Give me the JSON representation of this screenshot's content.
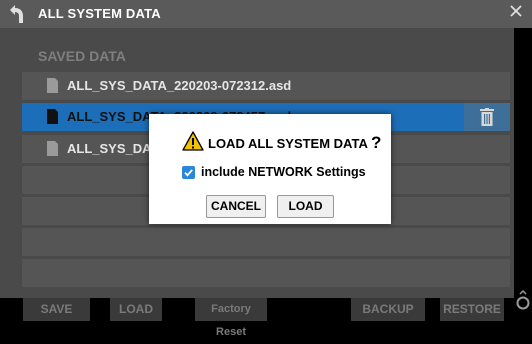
{
  "header": {
    "title": "ALL SYSTEM DATA"
  },
  "section": {
    "label": "SAVED DATA"
  },
  "files": [
    {
      "name": "ALL_SYS_DATA_220203-072312.asd",
      "selected": false
    },
    {
      "name": "ALL_SYS_DATA_220203-072457.asd",
      "selected": true
    },
    {
      "name": "ALL_SYS_DATA_",
      "selected": false
    }
  ],
  "footer": {
    "save": "SAVE",
    "load": "LOAD",
    "factory_reset": "Factory Reset",
    "backup": "BACKUP",
    "restore": "RESTORE"
  },
  "dialog": {
    "title": "LOAD ALL SYSTEM DATA",
    "question_mark": "?",
    "checkbox_label": "include NETWORK Settings",
    "checkbox_checked": true,
    "cancel": "CANCEL",
    "load": "LOAD"
  },
  "colors": {
    "selection": "#1d6eb8",
    "checkbox": "#2a86d8",
    "warning": "#f2c200"
  },
  "icons": [
    "back-arrow-icon",
    "close-icon",
    "file-icon",
    "trash-icon",
    "warning-icon",
    "checkmark-icon",
    "scroll-knob-icon"
  ]
}
